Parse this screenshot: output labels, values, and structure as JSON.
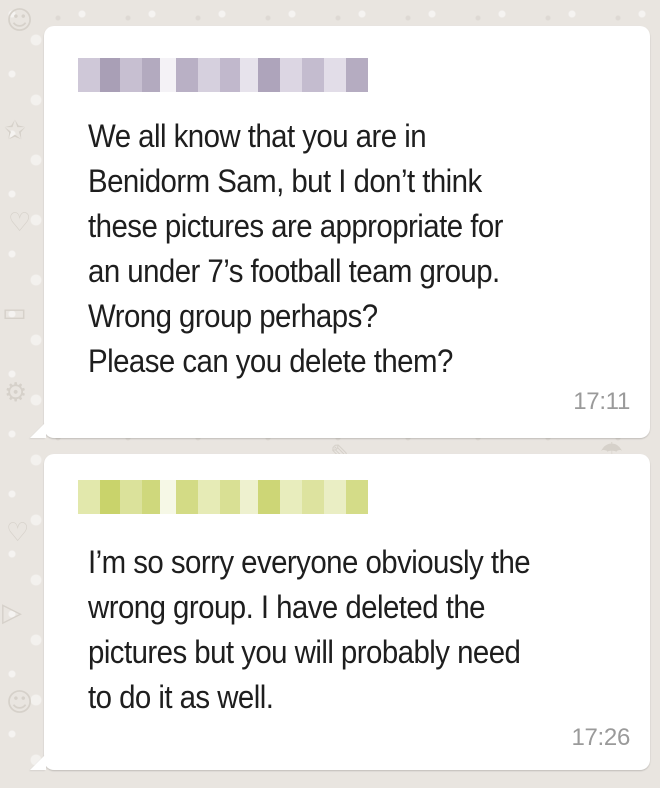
{
  "chat": {
    "background_color": "#e9e5e0",
    "bubble_color": "#ffffff",
    "messages": [
      {
        "sender_name_blurred": true,
        "sender_color": "#b7afc2",
        "text": "We all know that you are in\nBenidorm Sam, but I don’t think\nthese pictures are appropriate for\nan under 7’s football team group.\nWrong group perhaps?\nPlease can you delete them?",
        "time": "17:11"
      },
      {
        "sender_name_blurred": true,
        "sender_color": "#d6df8e",
        "text": "I’m so sorry everyone obviously the\nwrong group. I have deleted the\npictures but you will probably need\nto do it as well.",
        "time": "17:26"
      }
    ]
  }
}
